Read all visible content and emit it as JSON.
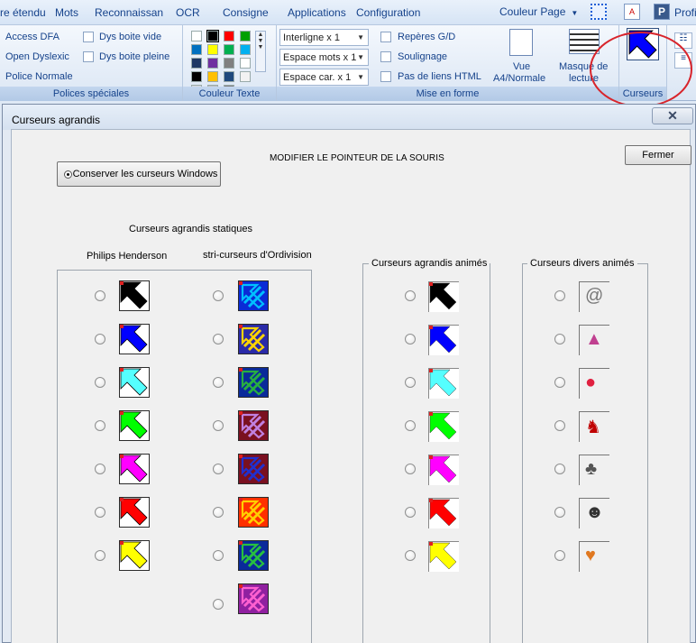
{
  "menubar": {
    "items": [
      "re étendu",
      "Mots",
      "Reconnaissan",
      "OCR",
      "Consigne",
      "Applications",
      "Configuration"
    ],
    "couleur_page": "Couleur Page",
    "profile": "Profi"
  },
  "ribbon": {
    "polices": {
      "items": [
        "Access DFA",
        "Open Dyslexic",
        "Police Normale"
      ],
      "checks": [
        "Dys boite vide",
        "Dys boite pleine"
      ],
      "label": "Polices spéciales"
    },
    "couleur_texte": {
      "label": "Couleur Texte",
      "swatches": [
        "#ffffff",
        "#000000",
        "#ff0000",
        "#00a000",
        "#0070c0",
        "#ffff00",
        "#00b050",
        "#00b0f0",
        "#1f3864",
        "#7030a0",
        "#808080",
        "#ffffff",
        "#000000",
        "#ffc000",
        "#1f497d",
        "#f2f2f2",
        "#d9d9d9",
        "#bfbfbf",
        "#808080"
      ]
    },
    "mise_en_forme": {
      "combos": [
        "Interligne x 1",
        "Espace mots x 1",
        "Espace car. x 1"
      ],
      "checks": [
        "Repères G/D",
        "Soulignage",
        "Pas de liens HTML"
      ],
      "vue_label": "Vue",
      "vue_sub": "A4/Normale",
      "masque_label": "Masque de",
      "masque_sub": "lecture",
      "label": "Mise en forme"
    },
    "curseurs": {
      "label": "Curseurs"
    }
  },
  "dialog": {
    "title": "Curseurs agrandis",
    "close_glyph": "✕",
    "heading": "MODIFIER LE POINTEUR DE LA SOURIS",
    "fermer": "Fermer",
    "conserver": "Conserver les curseurs Windows",
    "static_title": "Curseurs agrandis statiques",
    "philips_label": "Philips Henderson",
    "stri_label": "stri-curseurs d'Ordivision",
    "animes_label": "Curseurs agrandis  animés",
    "divers_label": "Curseurs divers  animés"
  },
  "cursors": {
    "philips_colors": [
      "#000000",
      "#0000ff",
      "#55ffff",
      "#00ff00",
      "#ff00ff",
      "#ff0000",
      "#ffff00"
    ],
    "stri_colors": [
      {
        "a": "#0a2bd6",
        "b": "#00c0ff"
      },
      {
        "a": "#2a2aa8",
        "b": "#ffd400"
      },
      {
        "a": "#0a2a9a",
        "b": "#28b040"
      },
      {
        "a": "#7a1020",
        "b": "#c080e0"
      },
      {
        "a": "#7a1020",
        "b": "#2030d0"
      },
      {
        "a": "#ff3000",
        "b": "#ffd000"
      },
      {
        "a": "#0a2a9a",
        "b": "#28c040"
      },
      {
        "a": "#9020a0",
        "b": "#ff60d0"
      }
    ],
    "anim_colors": [
      "#000000",
      "#0000ff",
      "#55ffff",
      "#00ff00",
      "#ff00ff",
      "#ff0000",
      "#ffff00"
    ],
    "divers_icons": [
      "spiral-search-icon",
      "rainbow-triangle-icon",
      "red-arrow-ball-icon",
      "running-horse-icon",
      "dog-icon",
      "cat-icon",
      "corgi-icon"
    ]
  }
}
